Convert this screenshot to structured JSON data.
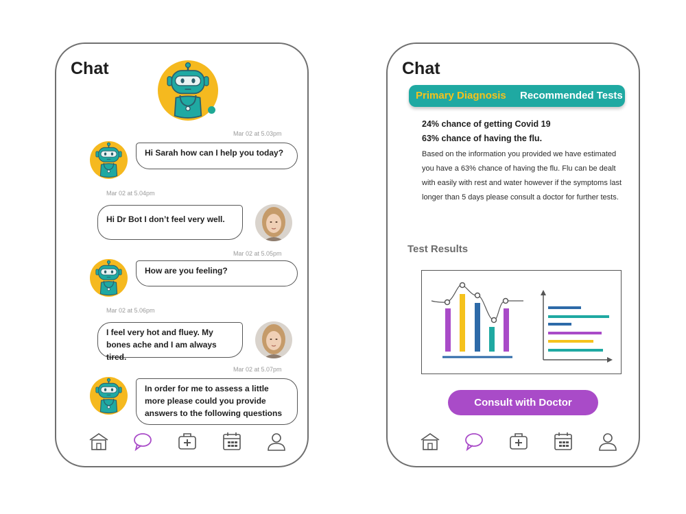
{
  "left_screen": {
    "title": "Chat",
    "messages": [
      {
        "from": "bot",
        "time": "Mar 02 at 5.03pm",
        "text": "Hi Sarah how can I help you today?"
      },
      {
        "from": "user",
        "time": "Mar 02 at 5.04pm",
        "text": "Hi Dr Bot I don’t feel very well."
      },
      {
        "from": "bot",
        "time": "Mar 02 at 5.05pm",
        "text": "How are you feeling?"
      },
      {
        "from": "user",
        "time": "Mar 02 at 5.06pm",
        "text": "I feel very hot and fluey. My bones ache and I am always tired."
      },
      {
        "from": "bot",
        "time": "Mar 02 at 5.07pm",
        "text": "In order for me to assess a little more please could you provide answers to the following questions"
      }
    ]
  },
  "right_screen": {
    "title": "Chat",
    "tabs": [
      "Primary Diagnosis",
      "Recommended Tests"
    ],
    "diagnosis": {
      "line1": "24% chance of getting Covid 19",
      "line2": "63% chance of having the flu.",
      "body": "Based on the information you provided we have estimated you have a 63% chance of having the flu. Flu can be dealt with easily with rest and water however if the symptoms last longer than 5 days please consult a doctor for further tests."
    },
    "test_results_title": "Test Results",
    "consult_label": "Consult with Doctor"
  },
  "nav_items": [
    "home-icon",
    "chat-icon",
    "medical-kit-icon",
    "calendar-icon",
    "profile-icon"
  ],
  "colors": {
    "active_nav": "#a94bc8",
    "teal": "#1fa9a2",
    "yellow": "#f5c21c",
    "purple": "#a94bc8",
    "blue": "#2d6aa8"
  }
}
